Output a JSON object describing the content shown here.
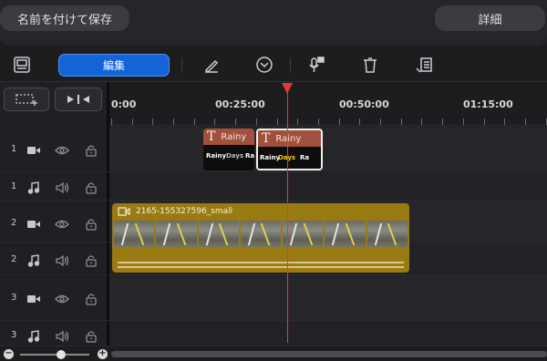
{
  "header": {
    "save_as_label": "名前を付けて保存",
    "details_label": "詳細"
  },
  "toolbar": {
    "edit_label": "編集",
    "icons": [
      "layout-icon",
      "pen-icon",
      "chevron-circle-icon",
      "voiceover-icon",
      "trash-icon",
      "export-list-icon"
    ]
  },
  "ruler": {
    "ticks": [
      "0:00",
      "00:25:00",
      "00:50:00",
      "01:15:00"
    ]
  },
  "tracks": [
    {
      "number": "1",
      "type": "video"
    },
    {
      "number": "1",
      "type": "audio"
    },
    {
      "number": "2",
      "type": "video"
    },
    {
      "number": "2",
      "type": "audio"
    },
    {
      "number": "3",
      "type": "video"
    },
    {
      "number": "3",
      "type": "audio"
    }
  ],
  "clips": {
    "title_clip_1": {
      "label": "Rainy",
      "preview_a": "Rainy",
      "preview_b": "Days",
      "preview_c": "Ra"
    },
    "title_clip_2": {
      "label": "Rainy",
      "preview_a": "Rainy",
      "preview_b": "Days",
      "preview_c": "Ra"
    },
    "video_clip": {
      "label": "2165-155327596_small"
    }
  },
  "colors": {
    "accent": "#1464d8",
    "playhead": "#e23b3b",
    "title_clip": "#a0503c",
    "video_clip": "#9a7a12"
  }
}
